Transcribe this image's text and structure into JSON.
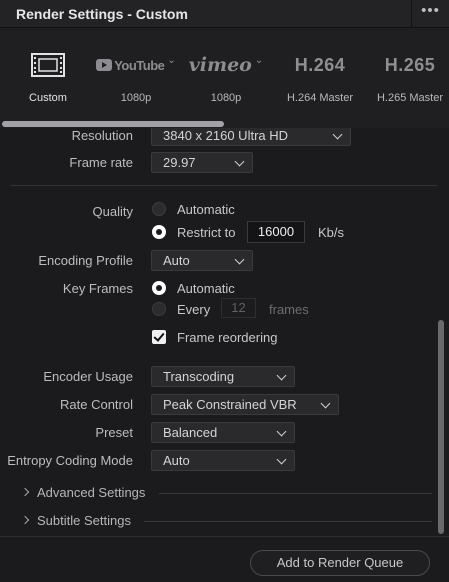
{
  "window": {
    "title": "Render Settings - Custom",
    "more_label": "•••"
  },
  "presets": [
    {
      "logo": "",
      "icon": "film-strip-icon",
      "label": "Custom",
      "active": true
    },
    {
      "logo": "YouTube",
      "icon": "youtube-logo",
      "label": "1080p",
      "active": false
    },
    {
      "logo": "vimeo",
      "icon": "vimeo-logo",
      "label": "1080p",
      "active": false
    },
    {
      "logo": "H.264",
      "icon": "h264-logo",
      "label": "H.264 Master",
      "active": false
    },
    {
      "logo": "H.265",
      "icon": "h265-logo",
      "label": "H.265 Master",
      "active": false
    }
  ],
  "settings": {
    "resolution": {
      "label": "Resolution",
      "value": "3840 x 2160 Ultra HD"
    },
    "frame_rate": {
      "label": "Frame rate",
      "value": "29.97"
    },
    "quality": {
      "label": "Quality",
      "automatic": "Automatic",
      "restrict": "Restrict to",
      "restrict_value": "16000",
      "unit": "Kb/s",
      "selected": "restrict"
    },
    "encoding_profile": {
      "label": "Encoding Profile",
      "value": "Auto"
    },
    "key_frames": {
      "label": "Key Frames",
      "automatic": "Automatic",
      "every": "Every",
      "every_value": "12",
      "unit": "frames",
      "selected": "automatic"
    },
    "frame_reordering": {
      "label": "Frame reordering",
      "checked": true
    },
    "encoder_usage": {
      "label": "Encoder Usage",
      "value": "Transcoding"
    },
    "rate_control": {
      "label": "Rate Control",
      "value": "Peak Constrained VBR"
    },
    "preset": {
      "label": "Preset",
      "value": "Balanced"
    },
    "entropy_coding": {
      "label": "Entropy Coding Mode",
      "value": "Auto"
    }
  },
  "sections": {
    "advanced": "Advanced Settings",
    "subtitle": "Subtitle Settings"
  },
  "footer": {
    "add_to_queue": "Add to Render Queue"
  },
  "colors": {
    "background": "#1b1b1d",
    "panel": "#1f1f22",
    "control": "#2a2a2d",
    "text": "#c9c9c9"
  }
}
